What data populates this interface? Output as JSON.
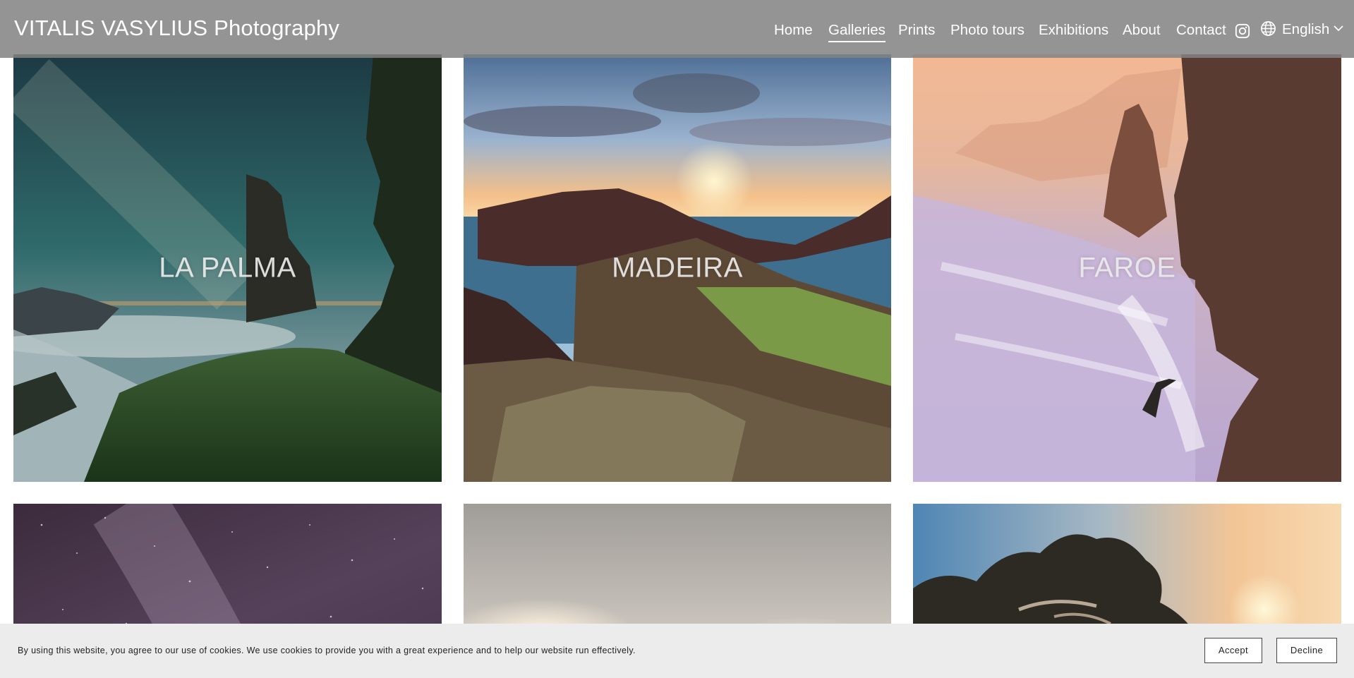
{
  "header": {
    "site_title": "VITALIS VASYLIUS Photography",
    "nav": [
      {
        "label": "Home",
        "active": false
      },
      {
        "label": "Galleries",
        "active": true
      },
      {
        "label": "Prints",
        "active": false
      },
      {
        "label": "Photo tours",
        "active": false
      },
      {
        "label": "Exhibitions",
        "active": false
      },
      {
        "label": "About",
        "active": false
      },
      {
        "label": "Contact",
        "active": false
      }
    ],
    "social_icon": "instagram-icon",
    "language": {
      "icon": "globe-icon",
      "label": "English",
      "dropdown_icon": "chevron-down-icon"
    }
  },
  "galleries": [
    {
      "title": "LA PALMA"
    },
    {
      "title": "MADEIRA"
    },
    {
      "title": "FAROE"
    },
    {
      "title": ""
    },
    {
      "title": ""
    },
    {
      "title": ""
    }
  ],
  "cookie_bar": {
    "text": "By using this website, you agree to our use of cookies. We use cookies to provide you with a great experience and to help our website run effectively.",
    "accept_label": "Accept",
    "decline_label": "Decline"
  }
}
